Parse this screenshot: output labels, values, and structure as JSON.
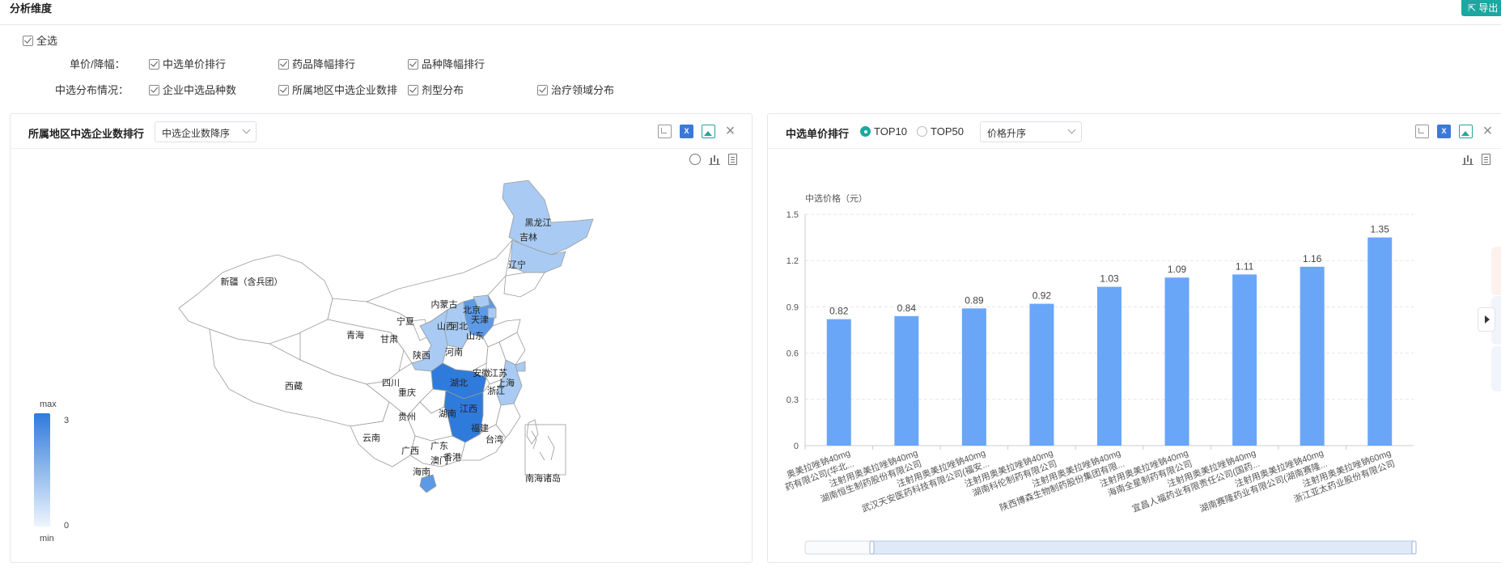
{
  "page": {
    "title": "分析维度",
    "export_label": "导出"
  },
  "filters": {
    "select_all": "全选",
    "price_label": "单价/降幅：",
    "price_options": [
      "中选单价排行",
      "药品降幅排行",
      "品种降幅排行"
    ],
    "dist_label": "中选分布情况：",
    "dist_options": [
      "企业中选品种数",
      "所属地区中选企业数排",
      "剂型分布",
      "治疗领域分布"
    ]
  },
  "map_panel": {
    "title": "所属地区中选企业数排行",
    "sort_select": "中选企业数降序",
    "legend": {
      "max_label": "max",
      "min_label": "min",
      "max_value": "3",
      "min_value": "0"
    },
    "regions": [
      "新疆（含兵团）",
      "西藏",
      "青海",
      "甘肃",
      "宁夏",
      "内蒙古",
      "黑龙江",
      "吉林",
      "辽宁",
      "北京",
      "天津",
      "河北",
      "山西",
      "山东",
      "陕西",
      "河南",
      "四川",
      "重庆",
      "湖北",
      "安徽",
      "江苏",
      "上海",
      "浙江",
      "贵州",
      "湖南",
      "江西",
      "云南",
      "广西",
      "广东",
      "福建",
      "台湾",
      "香港",
      "澳门",
      "海南",
      "南海诸岛"
    ],
    "colors": {
      "high": "#2f7bdc",
      "mid": "#5d9ae6",
      "low": "#a9cbf3",
      "none": "#ffffff"
    }
  },
  "price_panel": {
    "title": "中选单价排行",
    "radio_top10": "TOP10",
    "radio_top50": "TOP50",
    "sort_select": "价格升序",
    "bar_color": "#6aa6f8"
  },
  "chart_data": {
    "type": "bar",
    "ylabel": "中选价格（元）",
    "ylim": [
      0,
      1.5
    ],
    "yticks": [
      "0",
      "0.3",
      "0.6",
      "0.9",
      "1.2",
      "1.5"
    ],
    "values": [
      0.82,
      0.84,
      0.89,
      0.92,
      1.03,
      1.09,
      1.11,
      1.16,
      1.35
    ],
    "value_labels": [
      "0.82",
      "0.84",
      "0.89",
      "0.92",
      "1.03",
      "1.09",
      "1.11",
      "1.16",
      "1.35"
    ],
    "categories": [
      [
        "奥美拉唑钠40mg",
        "药有限公司(华北..."
      ],
      [
        "注射用奥美拉唑钠40mg",
        "湖南恒生制药股份有限公司"
      ],
      [
        "注射用奥美拉唑钠40mg",
        "武汉天安医药科技有限公司(福安..."
      ],
      [
        "注射用奥美拉唑钠40mg",
        "湖南科伦制药有限公司"
      ],
      [
        "注射用奥美拉唑钠40mg",
        "陕西博森生物制药股份集团有限..."
      ],
      [
        "注射用奥美拉唑钠40mg",
        "海南全星制药有限公司"
      ],
      [
        "注射用奥美拉唑钠40mg",
        "宜昌人福药业有限责任公司(国药..."
      ],
      [
        "注射用奥美拉唑钠40mg",
        "湖南赛隆药业有限公司(湖南赛隆..."
      ],
      [
        "注射用奥美拉唑钠60mg",
        "浙江亚太药业股份有限公司"
      ]
    ]
  }
}
